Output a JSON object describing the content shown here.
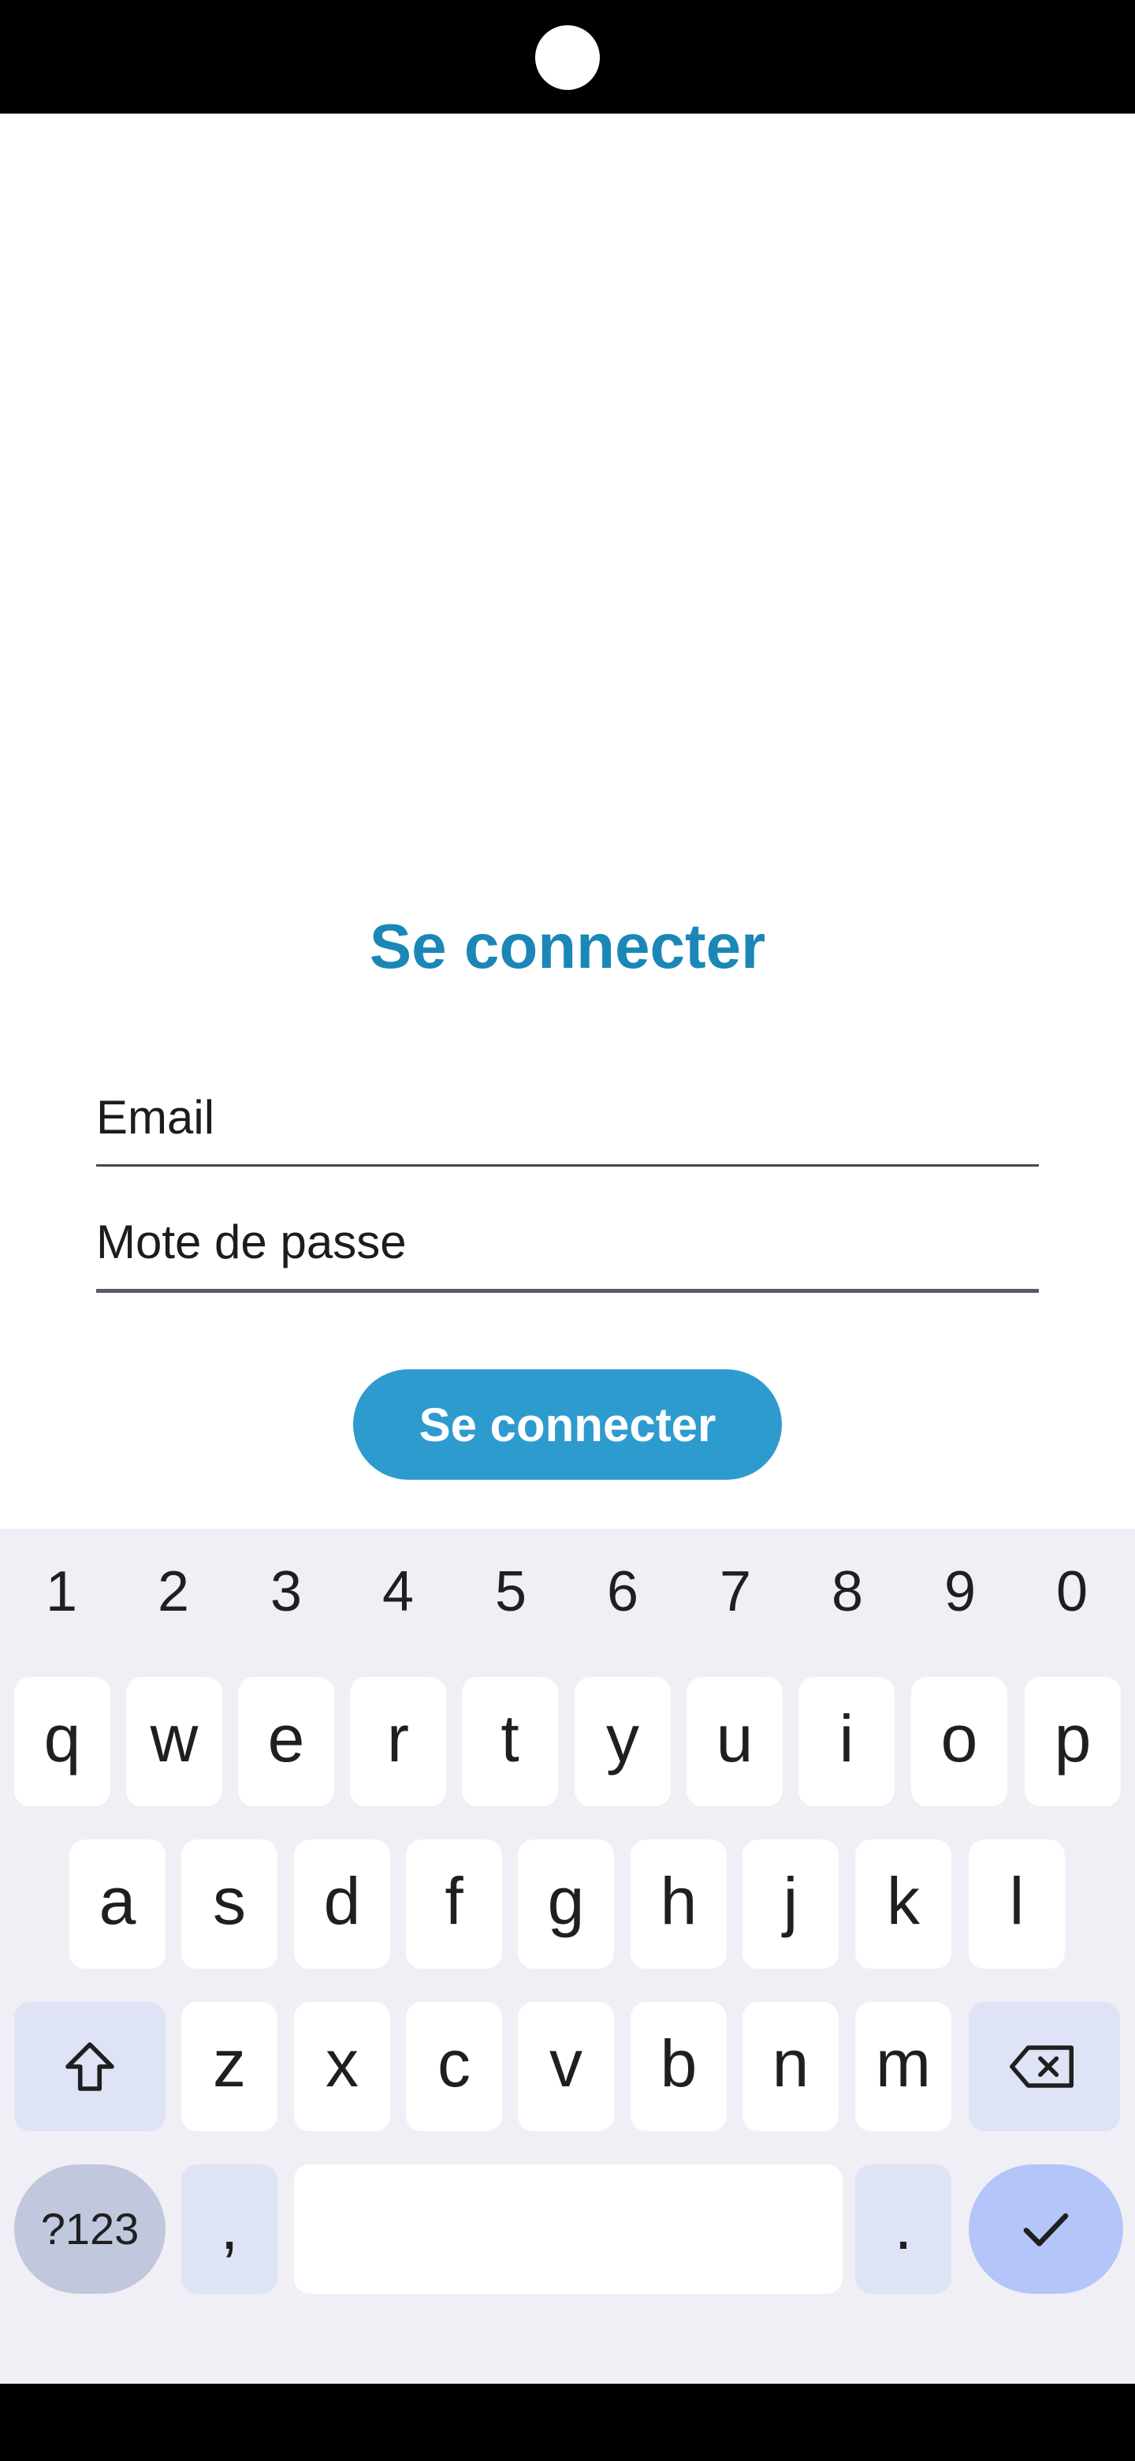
{
  "login": {
    "title": "Se connecter",
    "email_label": "Email",
    "password_label": "Mote de passe",
    "submit_label": "Se connecter"
  },
  "keyboard": {
    "numbers": [
      "1",
      "2",
      "3",
      "4",
      "5",
      "6",
      "7",
      "8",
      "9",
      "0"
    ],
    "row1": [
      "q",
      "w",
      "e",
      "r",
      "t",
      "y",
      "u",
      "i",
      "o",
      "p"
    ],
    "row2": [
      "a",
      "s",
      "d",
      "f",
      "g",
      "h",
      "j",
      "k",
      "l"
    ],
    "row3": [
      "z",
      "x",
      "c",
      "v",
      "b",
      "n",
      "m"
    ],
    "symbols_label": "?123",
    "comma": ",",
    "period": ".",
    "icons": {
      "shift": "shift-arrow-icon",
      "backspace": "backspace-icon",
      "enter": "checkmark-icon"
    }
  },
  "colors": {
    "title": "#1a87b7",
    "button": "#2e9bcf",
    "keyboard_bg": "#f0eff5",
    "enter_key": "#b4c5f9"
  }
}
